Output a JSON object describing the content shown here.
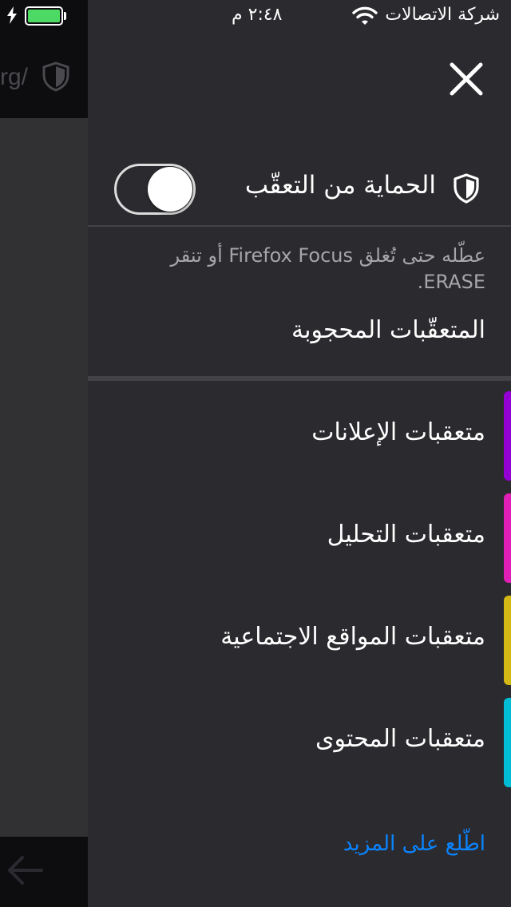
{
  "status_bar": {
    "carrier": "شركة الاتصالات",
    "time": "٢:٤٨ م",
    "battery_color": "#4cd964"
  },
  "background_browser": {
    "url_fragment": "rg/",
    "shield_icon": "shield-icon",
    "back_icon": "back-arrow-icon"
  },
  "panel": {
    "close_icon": "close-icon",
    "tracking_protection": {
      "title": "الحماية من التعقّب",
      "icon": "shield-icon",
      "enabled": true,
      "description": "عطّله حتى تُغلق Firefox Focus أو تنقر ERASE."
    },
    "blocked_heading": "المتعقّبات المحجوبة",
    "trackers": [
      {
        "label": "متعقبات الإعلانات",
        "color": "#9400d3"
      },
      {
        "label": "متعقبات التحليل",
        "color": "#e11fb6"
      },
      {
        "label": "متعقبات المواقع الاجتماعية",
        "color": "#d4b813"
      },
      {
        "label": "متعقبات المحتوى",
        "color": "#00bcd4"
      }
    ],
    "learn_more": "اطّلع على المزيد",
    "accent_color": "#0a84ff"
  }
}
